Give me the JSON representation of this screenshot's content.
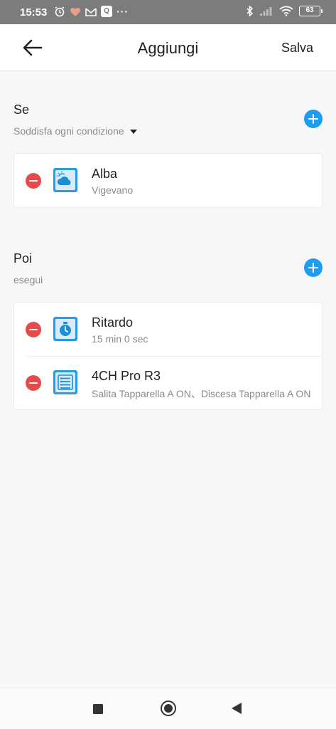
{
  "status_bar": {
    "time": "15:53",
    "left_icons": [
      "alarm-icon",
      "heart-icon",
      "mail-icon",
      "q-app-icon",
      "more-dots-icon"
    ],
    "q_app_letter": "Q",
    "more": "···",
    "right_icons": [
      "bluetooth-icon",
      "signal-icon",
      "wifi-icon",
      "battery-icon"
    ],
    "battery_level": "63"
  },
  "header": {
    "title": "Aggiungi",
    "save_label": "Salva"
  },
  "if_section": {
    "title": "Se",
    "condition_mode": "Soddisfa ogni condizione",
    "items": [
      {
        "title": "Alba",
        "subtitle": "Vigevano",
        "icon": "sunrise-weather-icon"
      }
    ]
  },
  "then_section": {
    "title": "Poi",
    "subtitle": "esegui",
    "items": [
      {
        "title": "Ritardo",
        "subtitle": "15 min 0 sec",
        "icon": "timer-icon"
      },
      {
        "title": "4CH Pro R3",
        "subtitle": "Salita Tapparella A ON、Discesa Tapparella A ON",
        "icon": "device-switch-icon"
      }
    ]
  },
  "colors": {
    "accent_blue": "#1e9cf0",
    "delete_red": "#e64a4a",
    "tile_blue": "#1a8fd6"
  }
}
